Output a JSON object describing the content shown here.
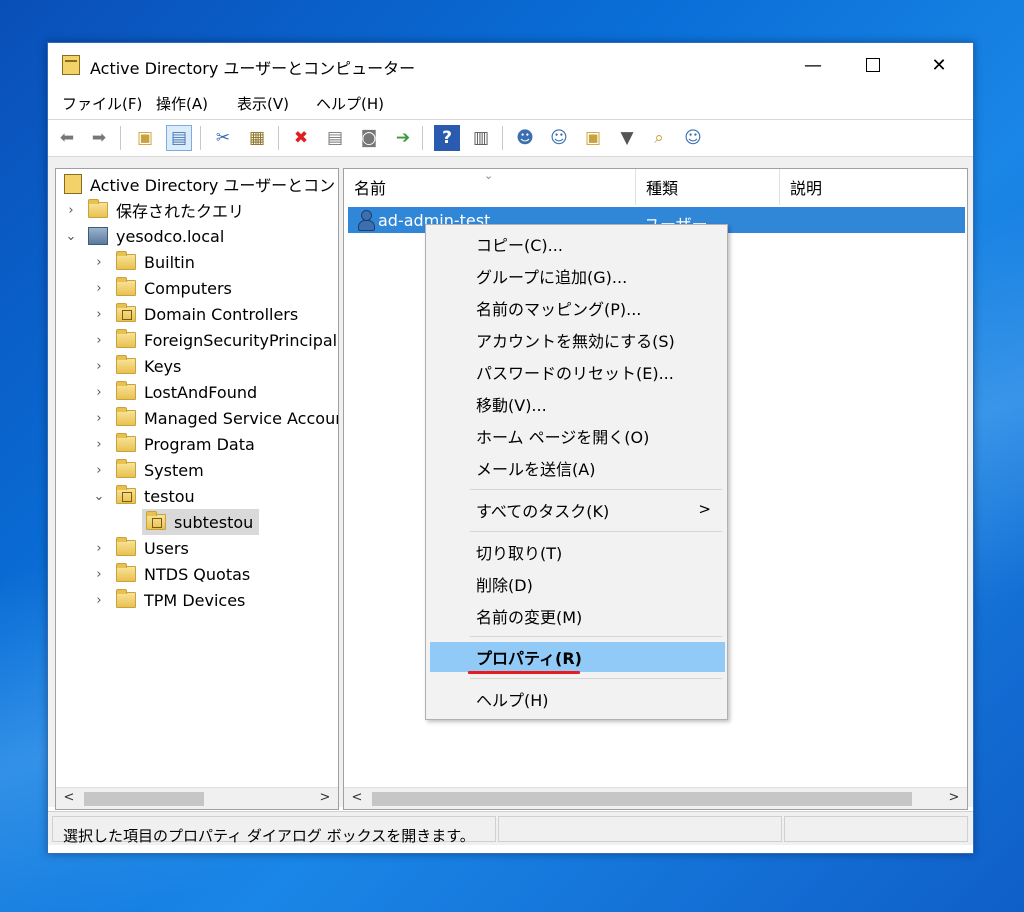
{
  "window": {
    "title": "Active Directory ユーザーとコンピューター",
    "controls": {
      "minimize": "—",
      "close": "✕"
    }
  },
  "menu": [
    "ファイル(F)",
    "操作(A)",
    "表示(V)",
    "ヘルプ(H)"
  ],
  "toolbar_icons": [
    "back-icon",
    "forward-icon",
    "up-folder-icon",
    "show-tree-icon",
    "cut-icon",
    "copy-icon",
    "delete-icon",
    "properties-icon",
    "refresh-icon",
    "export-icon",
    "help-icon",
    "show-action-pane-icon",
    "new-user-icon",
    "new-group-icon",
    "new-ou-icon",
    "filter-icon",
    "find-icon",
    "add-to-group-icon"
  ],
  "tree": {
    "root": "Active Directory ユーザーとコンピュー",
    "saved_queries": "保存されたクエリ",
    "domain": "yesodco.local",
    "items": [
      "Builtin",
      "Computers",
      "Domain Controllers",
      "ForeignSecurityPrincipals",
      "Keys",
      "LostAndFound",
      "Managed Service Accounts",
      "Program Data",
      "System",
      "testou",
      "subtestou",
      "Users",
      "NTDS Quotas",
      "TPM Devices"
    ]
  },
  "list": {
    "columns": [
      "名前",
      "種類",
      "説明"
    ],
    "rows": [
      {
        "name": "ad-admin-test",
        "type": "ユーザー",
        "description": ""
      }
    ]
  },
  "context_menu": {
    "items": [
      "コピー(C)...",
      "グループに追加(G)...",
      "名前のマッピング(P)...",
      "アカウントを無効にする(S)",
      "パスワードのリセット(E)...",
      "移動(V)...",
      "ホーム ページを開く(O)",
      "メールを送信(A)",
      "すべてのタスク(K)",
      "切り取り(T)",
      "削除(D)",
      "名前の変更(M)",
      "プロパティ(R)",
      "ヘルプ(H)"
    ],
    "submenu_arrow": ">",
    "highlighted": "プロパティ(R)"
  },
  "scroll": {
    "left": "<",
    "right": ">"
  },
  "status": "選択した項目のプロパティ ダイアログ ボックスを開きます。",
  "colors": {
    "selection": "#3087d8",
    "menu_highlight": "#91c9f7",
    "annotation": "#e81c1c"
  }
}
